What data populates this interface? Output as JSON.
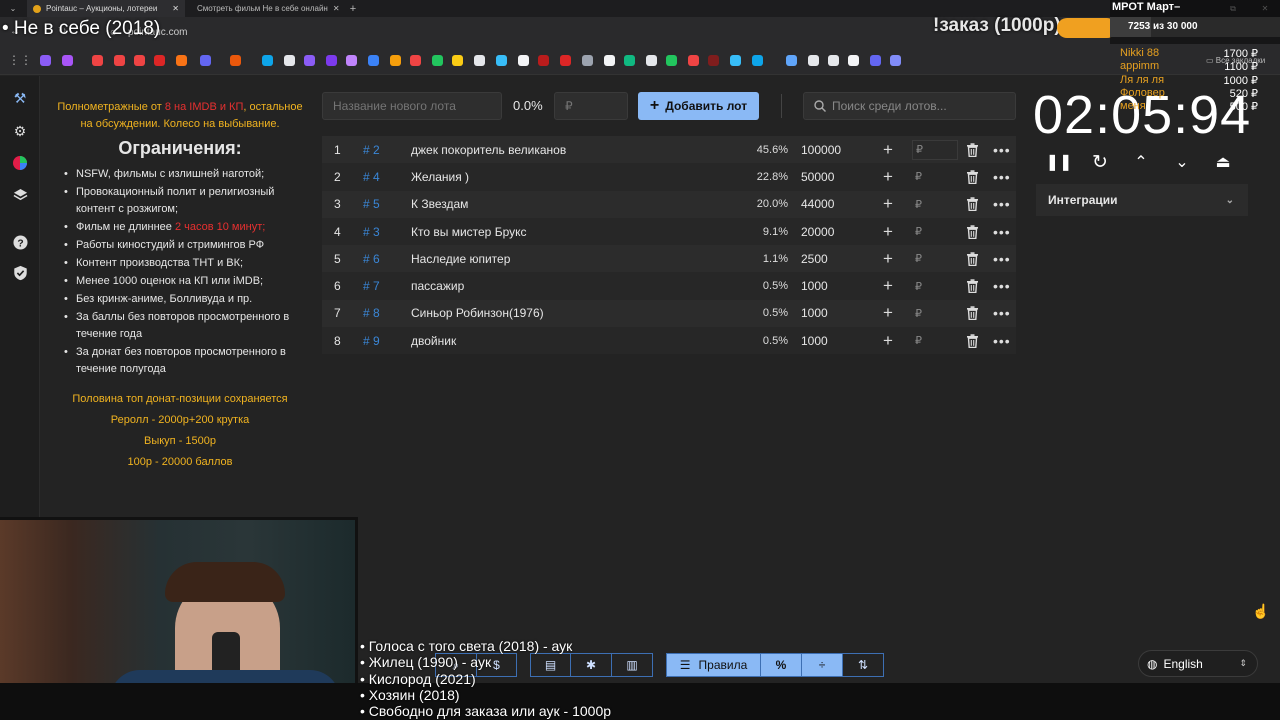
{
  "browser": {
    "tabs": [
      {
        "label": "Pointauc – Аукционы, лотереи"
      },
      {
        "label": "Смотреть фильм Не в себе онлайн"
      }
    ],
    "url": "pointauc.com",
    "bookmarks_label": "Все закладки"
  },
  "stream_overlay": {
    "title": "• Не в себе (2018)",
    "order_text": "!заказ (1000р)",
    "mrot_label": "МРОТ Март–",
    "progress_text": "7253  из 30 000",
    "donors": [
      {
        "name": "Nikki 88",
        "sum": "1700 ₽"
      },
      {
        "name": "appimm",
        "sum": "1100 ₽"
      },
      {
        "name": "Ля ля ля",
        "sum": "1000 ₽"
      },
      {
        "name": "Фоловер",
        "sum": "520 ₽"
      },
      {
        "name": "меня",
        "sum": "500 ₽"
      }
    ],
    "upcoming": [
      "• Голоса с того света (2018) - аук",
      "• Жилец (1990) - аук",
      "• Кислород (2021)",
      "• Хозяин (2018)",
      "• Свободно для заказа или аук - 1000р"
    ]
  },
  "rules_panel": {
    "intro_a": "Полнометражные от ",
    "intro_red": "8 на IMDB и КП",
    "intro_b": ", остальное на обсуждении. Колесо на выбывание.",
    "heading": "Ограничения:",
    "items": [
      "NSFW, фильмы с излишней наготой;",
      "Провокационный полит и религиозный контент с розжигом;",
      "Фильм не длиннее ",
      "Работы киностудий и стримингов РФ",
      "Контент производства ТНТ и ВК;",
      "Менее 1000 оценок на КП или iMDB;",
      "Без кринж-аниме, Болливуда и пр.",
      "За баллы без повторов просмотренного в течение года",
      "За донат без повторов просмотренного в течение полугода"
    ],
    "item3_red": "2 часов 10 минут;",
    "footer": [
      "Половина топ донат-позиции сохраняется",
      "Реролл - 2000р+200 крутка",
      "Выкуп - 1500р",
      "100р - 20000 баллов"
    ]
  },
  "controls": {
    "new_lot_placeholder": "Название нового лота",
    "new_lot_percent": "0.0%",
    "new_lot_amount_placeholder": "₽",
    "add_button": "Добавить лот",
    "search_placeholder": "Поиск среди лотов..."
  },
  "lots": [
    {
      "idx": "1",
      "num": "# 2",
      "name": "джек покоритель великанов",
      "pct": "45.6%",
      "amount": "100000"
    },
    {
      "idx": "2",
      "num": "# 4",
      "name": "Желания )",
      "pct": "22.8%",
      "amount": "50000"
    },
    {
      "idx": "3",
      "num": "# 5",
      "name": "К Звездам",
      "pct": "20.0%",
      "amount": "44000"
    },
    {
      "idx": "4",
      "num": "# 3",
      "name": "Кто вы мистер Брукс",
      "pct": "9.1%",
      "amount": "20000"
    },
    {
      "idx": "5",
      "num": "# 6",
      "name": "Наследие юпитер",
      "pct": "1.1%",
      "amount": "2500"
    },
    {
      "idx": "6",
      "num": "# 7",
      "name": "пассажир",
      "pct": "0.5%",
      "amount": "1000"
    },
    {
      "idx": "7",
      "num": "# 8",
      "name": "Синьор Робинзон(1976)",
      "pct": "0.5%",
      "amount": "1000"
    },
    {
      "idx": "8",
      "num": "# 9",
      "name": "двойник",
      "pct": "0.5%",
      "amount": "1000"
    }
  ],
  "rub_symbol": "₽",
  "timer": {
    "value": "02:05:94"
  },
  "integrations_label": "Интеграции",
  "toolbar": {
    "rules_label": "Правила",
    "percent_label": "%"
  },
  "language": {
    "selected": "English"
  },
  "colors": {
    "accent": "#8ab9f5",
    "orange": "#f0b320",
    "red": "#e63030",
    "lot_number": "#3a86d6"
  }
}
